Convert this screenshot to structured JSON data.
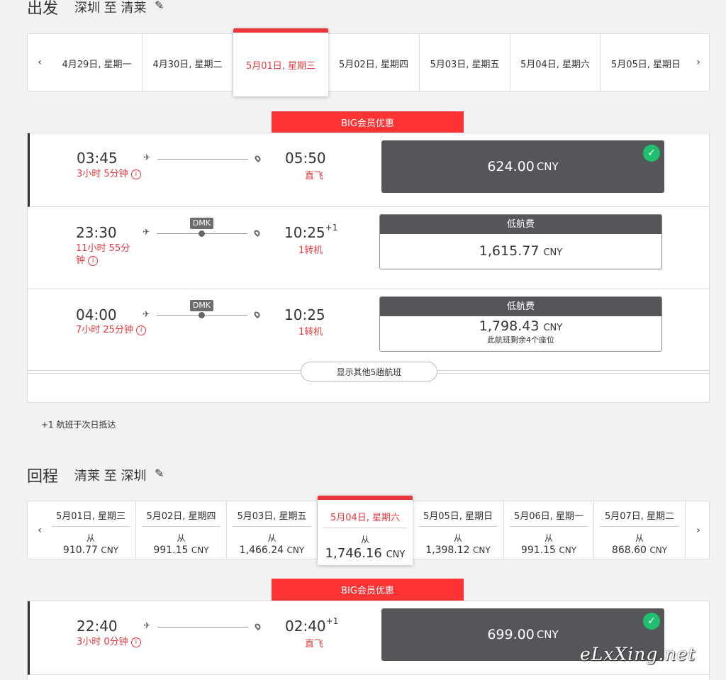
{
  "outbound": {
    "title": "出发",
    "route": "深圳 至 清莱",
    "dates": [
      {
        "label": "4月29日, 星期一"
      },
      {
        "label": "4月30日, 星期二"
      },
      {
        "label": "5月01日, 星期三",
        "selected": true
      },
      {
        "label": "5月02日, 星期四"
      },
      {
        "label": "5月03日, 星期五"
      },
      {
        "label": "5月04日, 星期六"
      },
      {
        "label": "5月05日, 星期日"
      }
    ],
    "promo": "BIG会员优惠",
    "flights": [
      {
        "depart": "03:45",
        "duration": "3小时 5分钟",
        "arrive": "05:50",
        "next_day": "",
        "stops": "直飞",
        "price": "624.00",
        "currency": "CNY",
        "selected": true
      },
      {
        "depart": "23:30",
        "duration_line1": "11小时 55分",
        "duration_line2": "钟",
        "arrive": "10:25",
        "next_day": "+1",
        "stops": "1转机",
        "via": "DMK",
        "fare_type": "低航费",
        "price": "1,615.77",
        "currency": "CNY"
      },
      {
        "depart": "04:00",
        "duration": "7小时 25分钟",
        "arrive": "10:25",
        "stops": "1转机",
        "via": "DMK",
        "fare_type": "低航费",
        "price": "1,798.43",
        "currency": "CNY",
        "note": "此航班剩余4个座位"
      }
    ],
    "more_button": "显示其他5趟航班",
    "footnote": "+1 航班于次日抵达"
  },
  "return": {
    "title": "回程",
    "route": "清莱 至 深圳",
    "from_label": "从",
    "dates": [
      {
        "label": "5月01日, 星期三",
        "price": "910.77",
        "currency": "CNY"
      },
      {
        "label": "5月02日, 星期四",
        "price": "991.15",
        "currency": "CNY"
      },
      {
        "label": "5月03日, 星期五",
        "price": "1,466.24",
        "currency": "CNY"
      },
      {
        "label": "5月04日, 星期六",
        "price": "1,746.16",
        "currency": "CNY",
        "selected": true
      },
      {
        "label": "5月05日, 星期日",
        "price": "1,398.12",
        "currency": "CNY"
      },
      {
        "label": "5月06日, 星期一",
        "price": "991.15",
        "currency": "CNY"
      },
      {
        "label": "5月07日, 星期二",
        "price": "868.60",
        "currency": "CNY"
      }
    ],
    "promo": "BIG会员优惠",
    "flights": [
      {
        "depart": "22:40",
        "duration": "3小时 0分钟",
        "arrive": "02:40",
        "next_day": "+1",
        "stops": "直飞",
        "price": "699.00",
        "currency": "CNY",
        "selected": true
      }
    ]
  },
  "icons": {
    "edit": "pencil-icon",
    "prev": "chevron-left-icon",
    "next": "chevron-right-icon",
    "depart": "plane-icon",
    "arrive": "map-pin-icon",
    "info": "info-icon",
    "selected": "check-icon"
  },
  "colors": {
    "accent": "#e8383d",
    "promo": "#ff3333",
    "fare_header": "#54565a",
    "check": "#1fbf6f"
  },
  "watermark": "eLxXing.net"
}
